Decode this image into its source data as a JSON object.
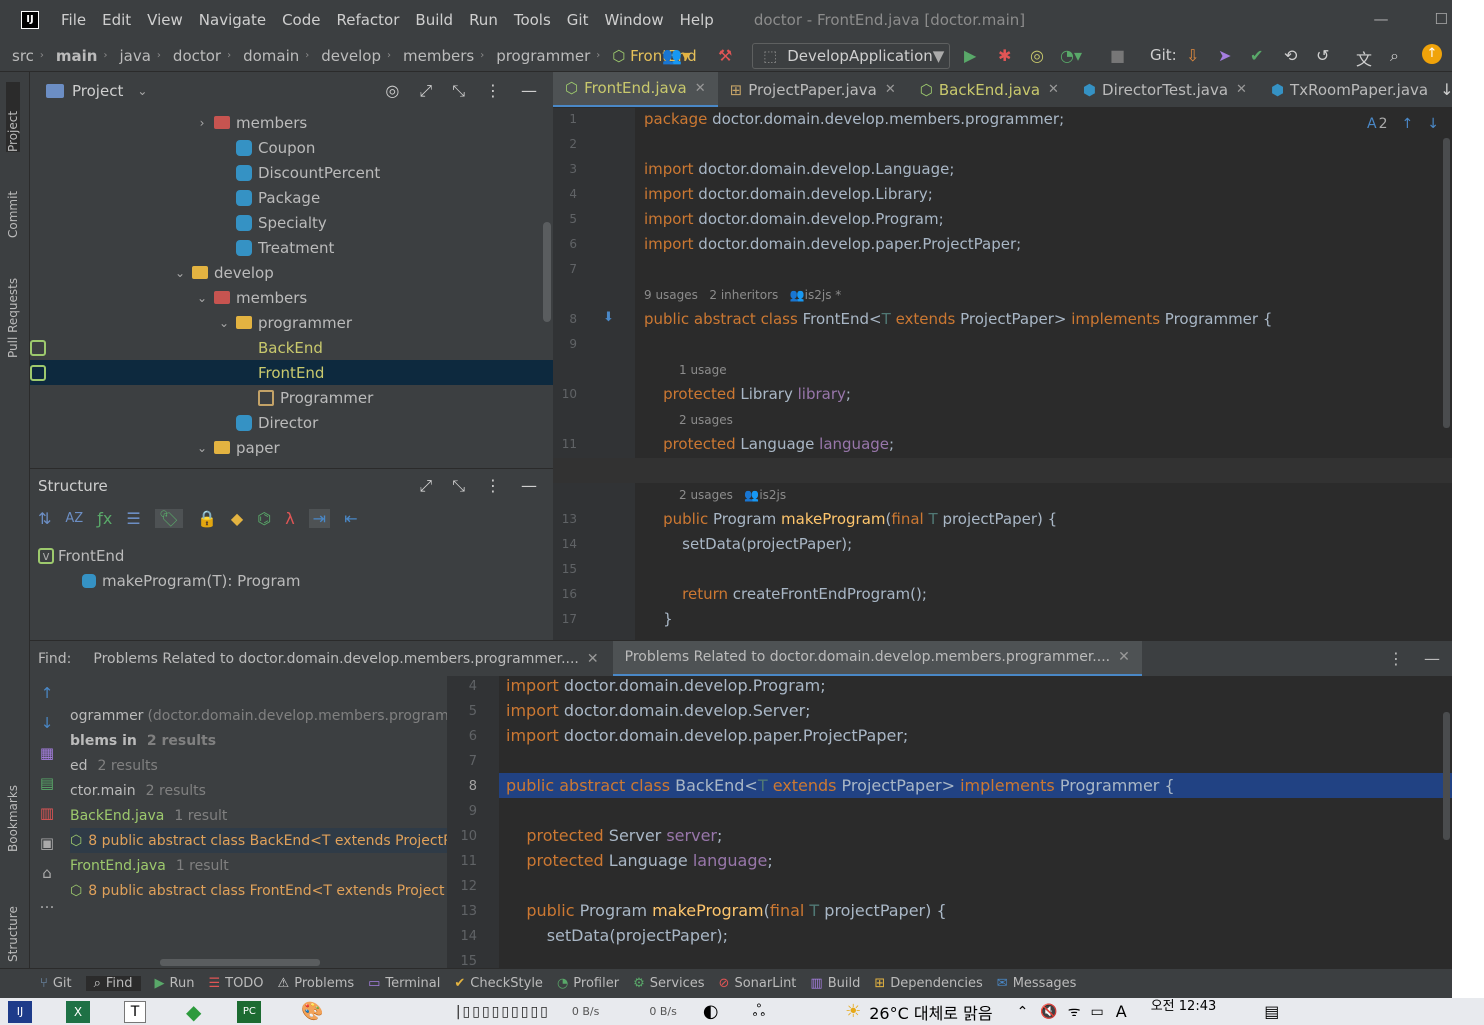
{
  "window": {
    "title": "doctor - FrontEnd.java [doctor.main]",
    "menu": [
      "File",
      "Edit",
      "View",
      "Navigate",
      "Code",
      "Refactor",
      "Build",
      "Run",
      "Tools",
      "Git",
      "Window",
      "Help"
    ]
  },
  "navbar": {
    "crumbs": [
      "src",
      "main",
      "java",
      "doctor",
      "domain",
      "develop",
      "members",
      "programmer"
    ],
    "current_class": "FrontEnd",
    "run_config": "DevelopApplication",
    "git_label": "Git:"
  },
  "left_strip": [
    "Project",
    "Commit",
    "Pull Requests",
    "Bookmarks",
    "Structure"
  ],
  "project_panel": {
    "title": "Project",
    "rows": [
      {
        "label": "members",
        "icon": "package-red",
        "indent": 0,
        "arrow": ">"
      },
      {
        "label": "Coupon",
        "icon": "class",
        "indent": 1,
        "arrow": ""
      },
      {
        "label": "DiscountPercent",
        "icon": "class",
        "indent": 1,
        "arrow": ""
      },
      {
        "label": "Package",
        "icon": "class",
        "indent": 1,
        "arrow": ""
      },
      {
        "label": "Specialty",
        "icon": "class",
        "indent": 1,
        "arrow": ""
      },
      {
        "label": "Treatment",
        "icon": "class",
        "indent": 1,
        "arrow": ""
      },
      {
        "label": "develop",
        "icon": "folder",
        "indent": -1,
        "arrow": "v"
      },
      {
        "label": "members",
        "icon": "package-red",
        "indent": 0,
        "arrow": "v"
      },
      {
        "label": "programmer",
        "icon": "folder",
        "indent": 1,
        "arrow": "v"
      },
      {
        "label": "BackEnd",
        "icon": "abstract",
        "indent": 2,
        "arrow": ""
      },
      {
        "label": "FrontEnd",
        "icon": "abstract",
        "indent": 2,
        "arrow": "",
        "selected": true
      },
      {
        "label": "Programmer",
        "icon": "interface",
        "indent": 2,
        "arrow": ""
      },
      {
        "label": "Director",
        "icon": "class",
        "indent": 1,
        "arrow": ""
      },
      {
        "label": "paper",
        "icon": "folder",
        "indent": 0,
        "arrow": "v"
      }
    ]
  },
  "structure_panel": {
    "title": "Structure",
    "root": "FrontEnd",
    "member": "makeProgram(T): Program"
  },
  "editor_tabs": [
    {
      "label": "FrontEnd.java",
      "active": true
    },
    {
      "label": "ProjectPaper.java",
      "active": false
    },
    {
      "label": "BackEnd.java",
      "active": false
    },
    {
      "label": "DirectorTest.java",
      "active": false
    },
    {
      "label": "TxRoomPaper.java",
      "active": false
    }
  ],
  "editor": {
    "inspection_count": "2",
    "hints": {
      "class": {
        "usages": "9 usages",
        "inheritors": "2 inheritors",
        "author": "is2js *"
      },
      "library": "1 usage",
      "language": "2 usages",
      "method": {
        "usages": "2 usages",
        "author": "is2js"
      }
    },
    "line_numbers": [
      "1",
      "2",
      "3",
      "4",
      "5",
      "6",
      "7",
      "8",
      "9",
      "10",
      "11",
      "12",
      "13",
      "14",
      "15",
      "16",
      "17"
    ]
  },
  "find_panel": {
    "label": "Find:",
    "tab1": "Problems Related to doctor.domain.develop.members.programmer....",
    "tab2": "Problems Related to doctor.domain.develop.members.programmer....",
    "tree": [
      {
        "text": "ogrammer",
        "sub": "(doctor.domain.develop.members.programmer"
      },
      {
        "text": "blems in",
        "sub": "2 results"
      },
      {
        "text": "ed",
        "sub": "2 results"
      },
      {
        "text": "ctor.main",
        "sub": "2 results"
      },
      {
        "text": "BackEnd.java",
        "sub": "1 result"
      },
      {
        "text": "8 public abstract class BackEnd<T extends ProjectP",
        "sub": ""
      },
      {
        "text": "FrontEnd.java",
        "sub": "1 result"
      },
      {
        "text": "8 public abstract class FrontEnd<T extends Project",
        "sub": ""
      }
    ],
    "preview_line_numbers": [
      "4",
      "5",
      "6",
      "7",
      "8",
      "9",
      "10",
      "11",
      "12",
      "13",
      "14",
      "15"
    ]
  },
  "tool_windows": [
    "Git",
    "Find",
    "Run",
    "TODO",
    "Problems",
    "Terminal",
    "CheckStyle",
    "Profiler",
    "Services",
    "SonarLint",
    "Build",
    "Dependencies",
    "Messages"
  ],
  "taskbar": {
    "net_up": "0 B/s",
    "net_down": "0 B/s",
    "weather": "26°C 대체로 맑음",
    "time": "오전 12:43"
  }
}
